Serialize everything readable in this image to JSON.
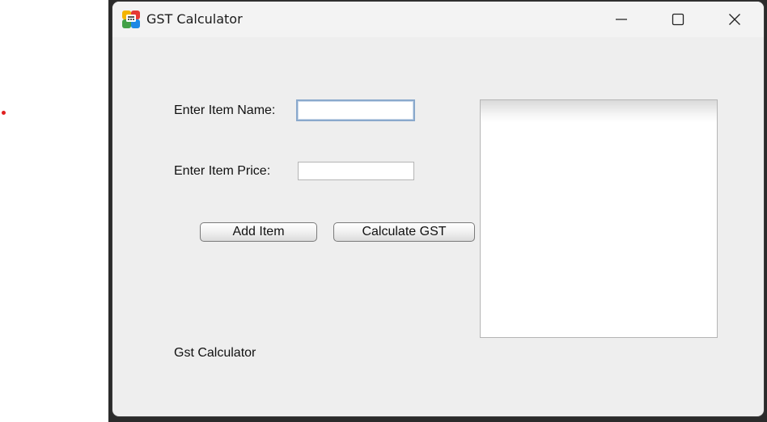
{
  "window": {
    "title": "GST Calculator"
  },
  "form": {
    "item_name_label": "Enter Item Name:",
    "item_name_value": "",
    "item_price_label": "Enter Item Price:",
    "item_price_value": ""
  },
  "buttons": {
    "add_item": "Add Item",
    "calculate_gst": "Calculate GST"
  },
  "output": {
    "text": ""
  },
  "footer": {
    "status_label": "Gst Calculator"
  }
}
